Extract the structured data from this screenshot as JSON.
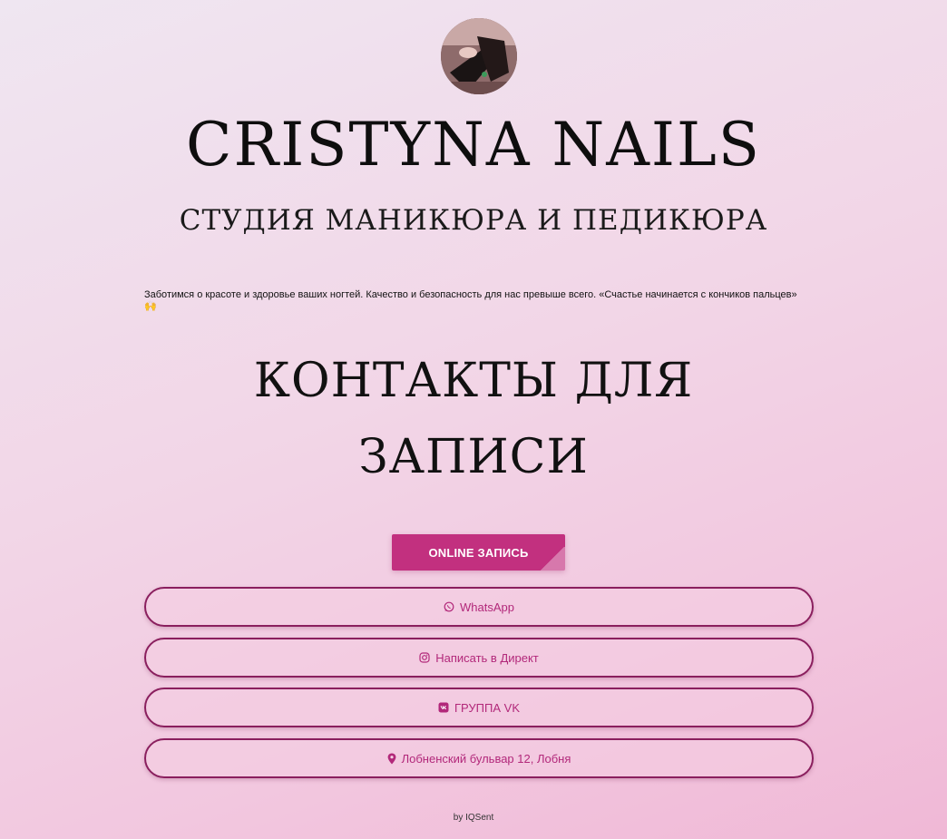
{
  "profile": {
    "title": "CRISTYNA NAILS",
    "subtitle": "СТУДИЯ МАНИКЮРА И ПЕДИКЮРА",
    "description": "Заботимся о красоте и здоровье ваших ногтей. Качество и безопасность для нас превыше всего. «Счастье начинается с кончиков пальцев» 🙌"
  },
  "contacts_heading": {
    "line1": "КОНТАКТЫ ДЛЯ",
    "line2": "ЗАПИСИ"
  },
  "buttons": {
    "online": "ONLINE ЗАПИСЬ",
    "whatsapp": "WhatsApp",
    "direct": "Написать в Директ",
    "vk": "ГРУППА VK",
    "address": "Лобненский бульвар 12, Лобня"
  },
  "icons": {
    "whatsapp": "whatsapp-icon",
    "instagram": "instagram-icon",
    "vk": "vk-icon",
    "location": "location-pin-icon"
  },
  "colors": {
    "accent": "#c2307f",
    "border": "#8a1f5e",
    "link_text": "#b2287a"
  },
  "footer": "by IQSent"
}
